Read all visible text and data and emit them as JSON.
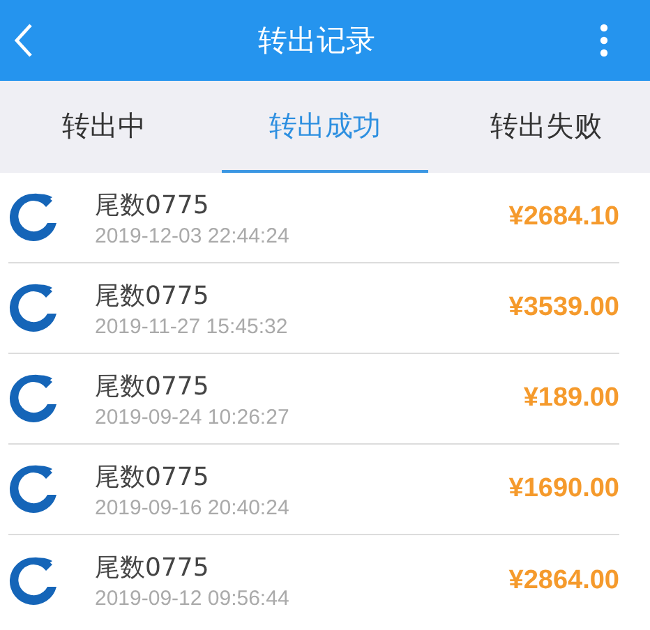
{
  "header": {
    "title": "转出记录"
  },
  "tabs": [
    {
      "label": "转出中",
      "selected": false
    },
    {
      "label": "转出成功",
      "selected": true
    },
    {
      "label": "转出失败",
      "selected": false
    }
  ],
  "records": [
    {
      "account": "尾数0775",
      "time": "2019-12-03 22:44:24",
      "amount": "¥2684.10"
    },
    {
      "account": "尾数0775",
      "time": "2019-11-27 15:45:32",
      "amount": "¥3539.00"
    },
    {
      "account": "尾数0775",
      "time": "2019-09-24 10:26:27",
      "amount": "¥189.00"
    },
    {
      "account": "尾数0775",
      "time": "2019-09-16 20:40:24",
      "amount": "¥1690.00"
    },
    {
      "account": "尾数0775",
      "time": "2019-09-12 09:56:44",
      "amount": "¥2864.00"
    }
  ]
}
